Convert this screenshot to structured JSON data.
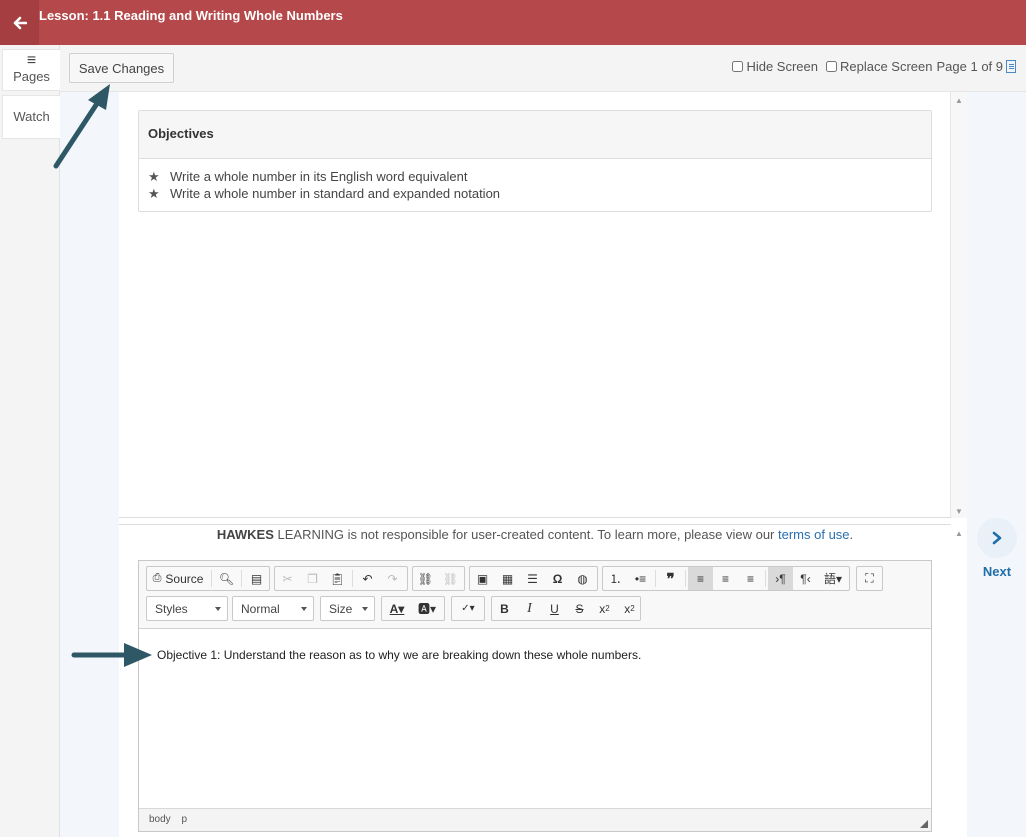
{
  "header": {
    "title": "Lesson: 1.1 Reading and Writing Whole Numbers",
    "back_icon": "arrow-left-icon",
    "color": "#b5484a"
  },
  "left_nav": {
    "pages_label": "Pages",
    "watch_label": "Watch"
  },
  "toolbar": {
    "save_label": "Save Changes",
    "hide_screen_label": "Hide Screen",
    "replace_screen_label": "Replace Screen",
    "page_indicator": "Page 1 of 9"
  },
  "objectives": {
    "heading": "Objectives",
    "items": [
      "Write a whole number in its English word equivalent",
      "Write a whole number in standard and expanded notation"
    ]
  },
  "disclaimer": {
    "brand": "HAWKES",
    "text": " LEARNING is not responsible for user-created content. To learn more, please view our ",
    "link": "terms of use",
    "end": "."
  },
  "editor": {
    "source_label": "Source",
    "styles_label": "Styles",
    "format_label": "Normal",
    "size_label": "Size",
    "content": "Objective 1: Understand the reason as to why we are breaking down these whole numbers.",
    "path": [
      "body",
      "p"
    ]
  },
  "nav": {
    "next_label": "Next"
  },
  "colors": {
    "accent": "#1f6ea8",
    "annotation_arrow": "#2f5866"
  }
}
